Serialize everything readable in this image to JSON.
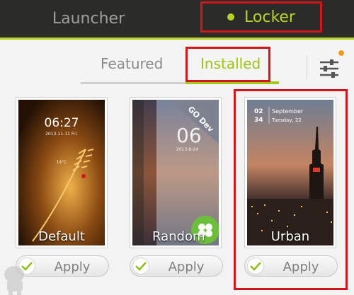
{
  "top_tabs": {
    "launcher": "Launcher",
    "locker": "Locker"
  },
  "sub_tabs": {
    "featured": "Featured",
    "installed": "Installed"
  },
  "colors": {
    "accent": "#b2d21b",
    "highlight": "#d4161b",
    "topbar": "#2b2c2a",
    "notification": "#f39a1e"
  },
  "themes": [
    {
      "name": "Default",
      "clock": "06:27",
      "date": "2013-11-11  Fri.",
      "temp": "14°C",
      "apply_label": "Apply",
      "checked": true
    },
    {
      "name": "Random",
      "badge": "GO Dev",
      "clock": "06",
      "date": "2013-8-24",
      "apply_label": "Apply",
      "checked": true
    },
    {
      "name": "Urban",
      "day": "02",
      "hour": "34",
      "month": "September",
      "weekday": "Tuesday, 22",
      "apply_label": "Apply",
      "checked": true
    }
  ],
  "icons": {
    "settings": "sliders-icon",
    "check": "check-icon",
    "app_badge": "clover-icon"
  }
}
